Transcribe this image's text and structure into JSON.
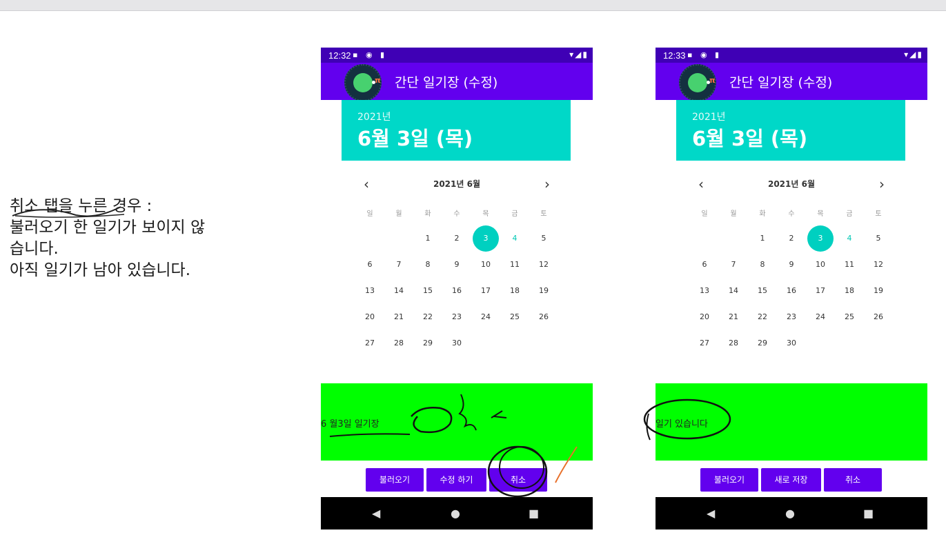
{
  "note": {
    "lines": [
      "취소 탭을 누른 경우 :",
      "불러오기 한 일기가 보이지 않",
      "습니다.",
      "아직 일기가 남아 있습니다."
    ]
  },
  "phones": [
    {
      "status_time": "12:32",
      "app_title": "간단 일기장 (수정)",
      "year": "2021년",
      "date": "6월 3일 (목)",
      "calendar_month": "2021년 6월",
      "diary_text": "6 월3일 일기장",
      "buttons": [
        "불러오기",
        "수정 하기",
        "취소"
      ]
    },
    {
      "status_time": "12:33",
      "app_title": "간단 일기장 (수정)",
      "year": "2021년",
      "date": "6월 3일 (목)",
      "calendar_month": "2021년 6월",
      "diary_text": "일기 있습니다",
      "buttons": [
        "불러오기",
        "새로 저장",
        "취소"
      ]
    }
  ],
  "calendar": {
    "weekdays": [
      "일",
      "월",
      "화",
      "수",
      "목",
      "금",
      "토"
    ],
    "selected_day": "3",
    "highlight_day": "4",
    "prev_icon": "‹",
    "next_icon": "›"
  },
  "status_icons": "▪ ◉ ▮",
  "status_right": "▾◢▮",
  "nav": {
    "back": "◀",
    "home": "●",
    "recents": "■"
  },
  "colors": {
    "purple": "#6200ee",
    "teal": "#00d8c8",
    "green": "#00ff00"
  }
}
